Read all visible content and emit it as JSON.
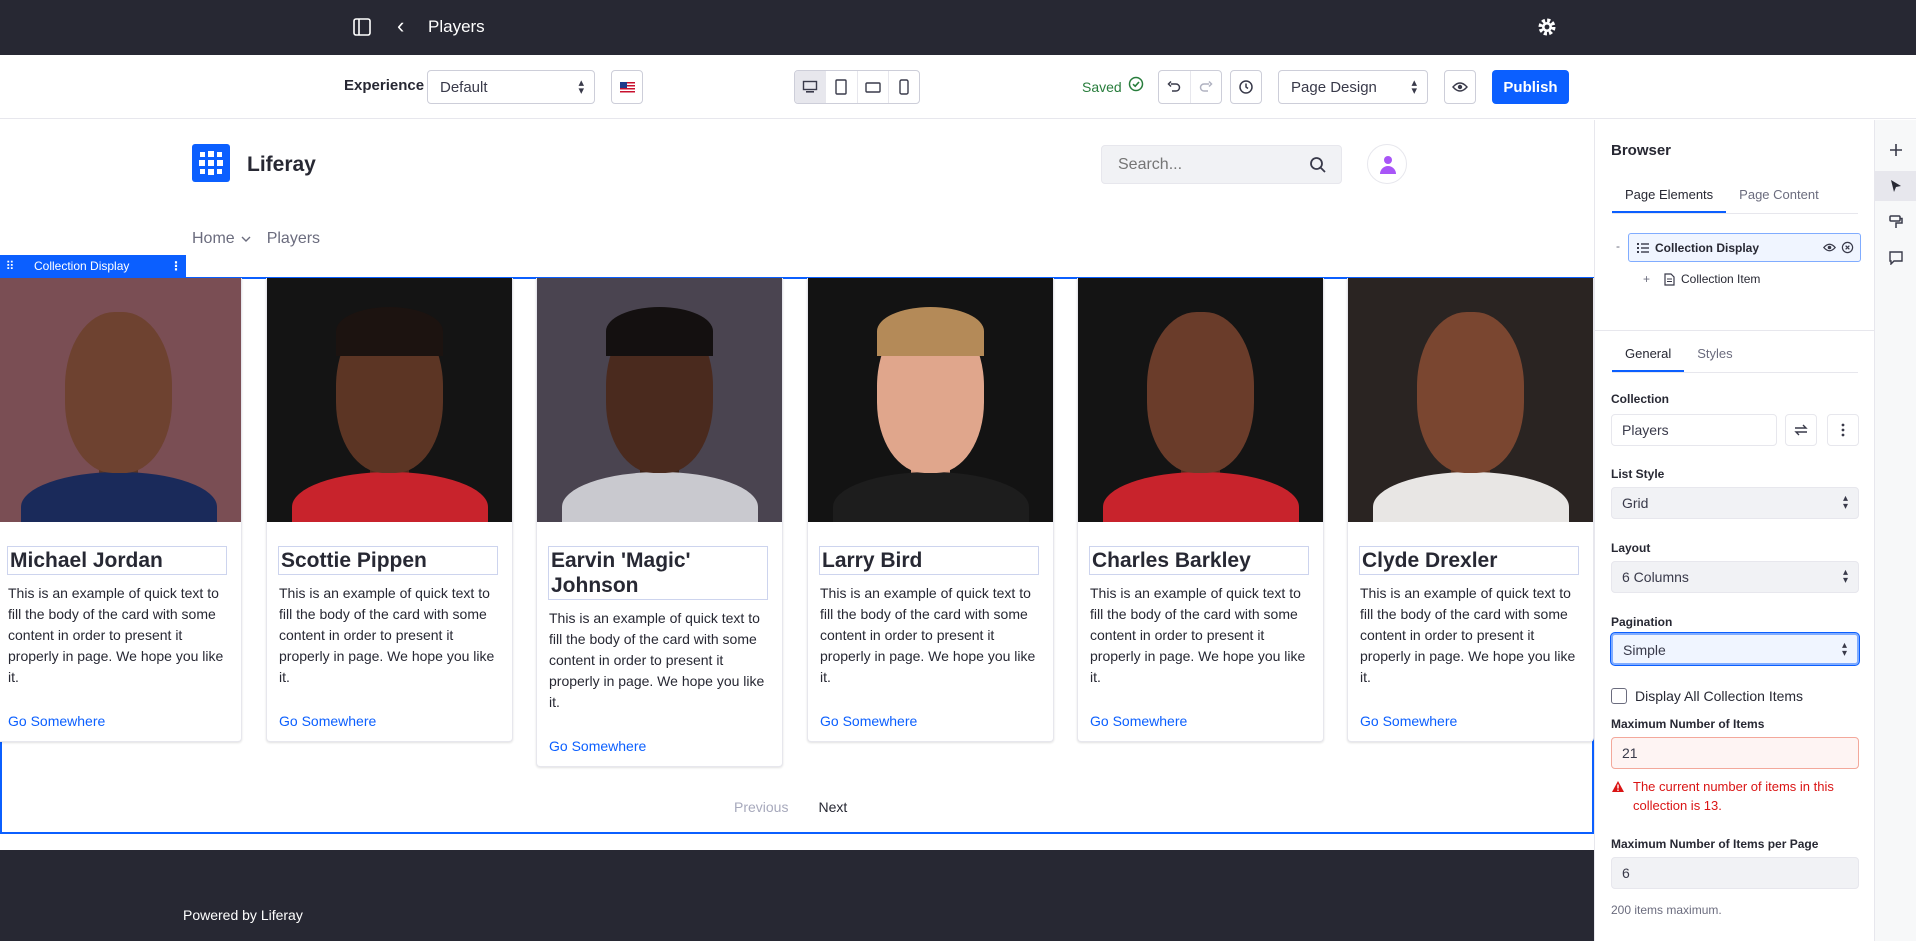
{
  "topbar": {
    "title": "Players"
  },
  "toolbar": {
    "experience_label": "Experience",
    "experience_value": "Default",
    "saved_label": "Saved",
    "mode_value": "Page Design",
    "publish_label": "Publish"
  },
  "site": {
    "name": "Liferay",
    "search_placeholder": "Search...",
    "nav": [
      "Home",
      "Players"
    ]
  },
  "fragment_label": "Collection Display",
  "cards": [
    {
      "name": "Michael Jordan",
      "description": "This is an example of quick text to fill the body of the card with some content in order to present it properly in page. We hope you like it.",
      "link": "Go Somewhere"
    },
    {
      "name": "Scottie Pippen",
      "description": "This is an example of quick text to fill the body of the card with some content in order to present it properly in page. We hope you like it.",
      "link": "Go Somewhere"
    },
    {
      "name": "Earvin 'Magic' Johnson",
      "description": "This is an example of quick text to fill the body of the card with some content in order to present it properly in page. We hope you like it.",
      "link": "Go Somewhere"
    },
    {
      "name": "Larry Bird",
      "description": "This is an example of quick text to fill the body of the card with some content in order to present it properly in page. We hope you like it.",
      "link": "Go Somewhere"
    },
    {
      "name": "Charles Barkley",
      "description": "This is an example of quick text to fill the body of the card with some content in order to present it properly in page. We hope you like it.",
      "link": "Go Somewhere"
    },
    {
      "name": "Clyde Drexler",
      "description": "This is an example of quick text to fill the body of the card with some content in order to present it properly in page. We hope you like it.",
      "link": "Go Somewhere"
    }
  ],
  "pagination": {
    "previous": "Previous",
    "next": "Next"
  },
  "footer": {
    "text": "Powered by Liferay"
  },
  "panel": {
    "heading": "Browser",
    "browser_tabs": [
      "Page Elements",
      "Page Content"
    ],
    "tree": {
      "root": "Collection Display",
      "child": "Collection Item"
    },
    "config_tabs": [
      "General",
      "Styles"
    ],
    "collection_label": "Collection",
    "collection_value": "Players",
    "list_style_label": "List Style",
    "list_style_value": "Grid",
    "layout_label": "Layout",
    "layout_value": "6 Columns",
    "pagination_label": "Pagination",
    "pagination_value": "Simple",
    "display_all_label": "Display All Collection Items",
    "max_items_label": "Maximum Number of Items",
    "max_items_value": "21",
    "warning": "The current number of items in this collection is 13.",
    "max_per_page_label": "Maximum Number of Items per Page",
    "max_per_page_value": "6",
    "help": "200 items maximum."
  },
  "colors": {
    "accent": "#0b5fff",
    "dark": "#272833",
    "success": "#287d3c",
    "danger": "#da1414"
  },
  "icons": [
    "sidebar-toggle-icon",
    "back-icon",
    "gear-icon",
    "flag-icon",
    "desktop-icon",
    "tablet-icon",
    "landscape-icon",
    "phone-icon",
    "check-circle-icon",
    "undo-icon",
    "redo-icon",
    "history-icon",
    "eye-icon",
    "search-icon",
    "user-icon",
    "drag-icon",
    "kebab-icon",
    "plus-icon",
    "pointer-icon",
    "paint-icon",
    "comment-icon",
    "warning-icon"
  ]
}
